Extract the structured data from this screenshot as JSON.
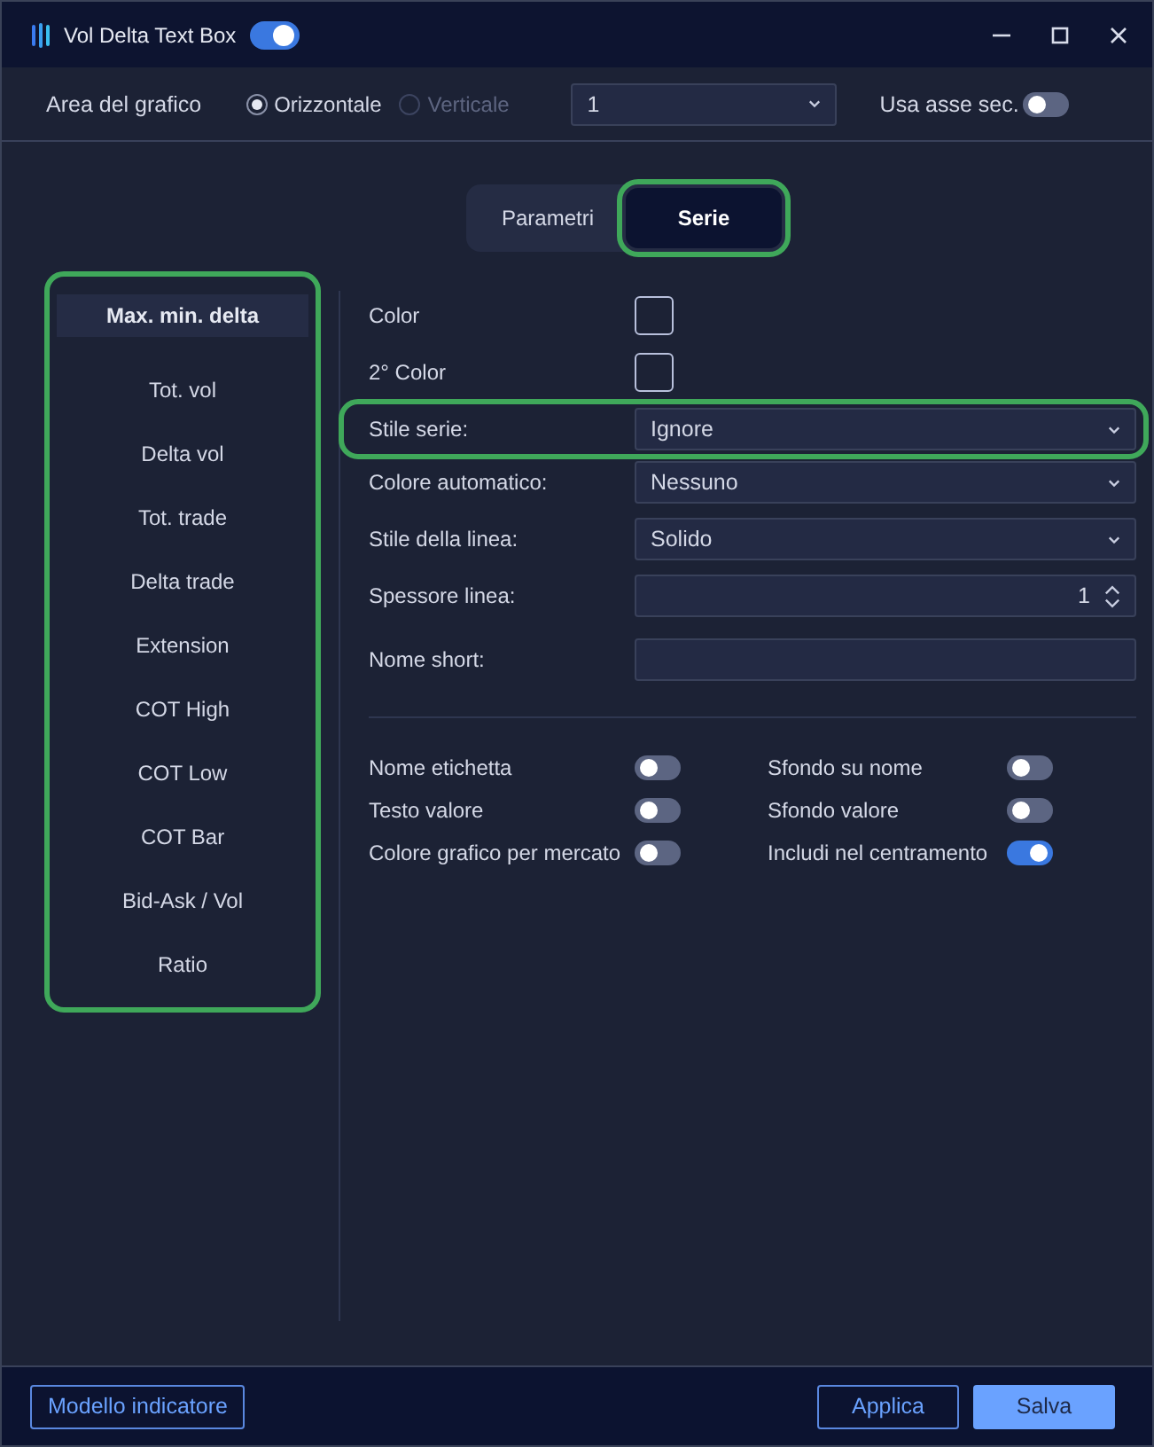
{
  "window": {
    "title": "Vol Delta Text Box",
    "enabled": true
  },
  "toolbar": {
    "label": "Area del grafico",
    "orientation": [
      {
        "label": "Orizzontale",
        "selected": true,
        "disabled": false
      },
      {
        "label": "Verticale",
        "selected": false,
        "disabled": true
      }
    ],
    "pane": "1",
    "secondary_axis": {
      "label": "Usa asse sec.",
      "on": false
    }
  },
  "tabs": [
    {
      "label": "Parametri",
      "selected": false,
      "highlighted": false
    },
    {
      "label": "Serie",
      "selected": true,
      "highlighted": true
    }
  ],
  "sidebar": {
    "highlighted": true,
    "items": [
      {
        "label": "Max. min. delta",
        "selected": true
      },
      {
        "label": "Tot. vol",
        "selected": false
      },
      {
        "label": "Delta vol",
        "selected": false
      },
      {
        "label": "Tot. trade",
        "selected": false
      },
      {
        "label": "Delta trade",
        "selected": false
      },
      {
        "label": "Extension",
        "selected": false
      },
      {
        "label": "COT High",
        "selected": false
      },
      {
        "label": "COT Low",
        "selected": false
      },
      {
        "label": "COT Bar",
        "selected": false
      },
      {
        "label": "Bid-Ask / Vol",
        "selected": false
      },
      {
        "label": "Ratio",
        "selected": false
      }
    ]
  },
  "fields": [
    {
      "kind": "swatch",
      "label": "Color",
      "highlighted": false
    },
    {
      "kind": "swatch",
      "label": "2° Color",
      "highlighted": false
    },
    {
      "kind": "select",
      "label": "Stile serie:",
      "value": "Ignore",
      "highlighted": true
    },
    {
      "kind": "select",
      "label": "Colore automatico:",
      "value": "Nessuno",
      "highlighted": false
    },
    {
      "kind": "select",
      "label": "Stile della linea:",
      "value": "Solido",
      "highlighted": false
    },
    {
      "kind": "spinner",
      "label": "Spessore linea:",
      "value": "1",
      "highlighted": false
    },
    {
      "kind": "text",
      "label": "Nome short:",
      "highlighted": false
    }
  ],
  "toggles": [
    {
      "label": "Nome etichetta",
      "on": false
    },
    {
      "label": "Sfondo su nome",
      "on": false
    },
    {
      "label": "Testo valore",
      "on": false
    },
    {
      "label": "Sfondo valore",
      "on": false
    },
    {
      "label": "Colore grafico per mercato",
      "on": false
    },
    {
      "label": "Includi nel centramento",
      "on": true
    }
  ],
  "footer": {
    "template_button": "Modello indicatore",
    "apply_button": "Applica",
    "save_button": "Salva"
  }
}
